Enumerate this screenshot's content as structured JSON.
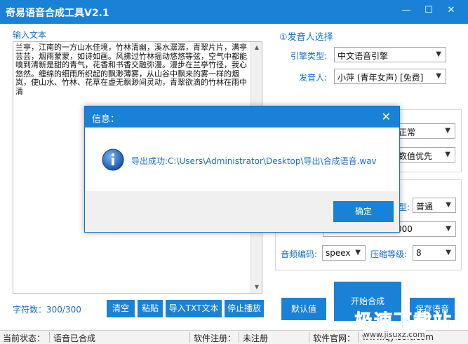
{
  "window": {
    "title": "奇易语音合成工具V2.1"
  },
  "left": {
    "section_label": "输入文本",
    "text_content": "兰亭，江南的一方山水佳境，竹林清幽，溪水潺潺，青翠片片，满亭芸芸，烟雨蒙蒙，如诗如画。风拂过竹林摇动悠悠等弦，空气中都能嗅到清新是甜的青气，花香和书香交融弥漫。漫步在兰亭竹径，我心悠然。缠绵的细雨所织起的飘渺薄雾，从山谷中飘来的雾一样的烟岚，使山水、竹林、花草在虚无飘渺间灵动，青翠欲滴的竹林在雨中清",
    "char_count_label": "字符数：",
    "char_count": "300/300",
    "buttons": {
      "clear": "清空",
      "paste": "粘贴",
      "import_txt": "导入TXT文本",
      "stop_play": "停止播放"
    }
  },
  "right": {
    "speaker_section": "①发音人选择",
    "engine_label": "引擎类型:",
    "engine_value": "中文语音引擎",
    "speaker_label": "发音人:",
    "speaker_value": "小萍 (青年女声) [免费]",
    "speed_value": "正常",
    "number_mode_value": "数值优先",
    "format_label_partial": "型:",
    "format_value": "普通",
    "samplerate_value": "000",
    "codec_label": "音频编码:",
    "codec_value": "speex",
    "compress_label": "压缩等级:",
    "compress_value": "8",
    "default_button": "默认值",
    "start_button": "开始合成",
    "save_button": "保存语音"
  },
  "statusbar": {
    "current_status_label": "当前状态：",
    "current_status_value": "语音已合成",
    "register_label": "软件注册：",
    "register_value": "未注册",
    "website_label": "软件官网：",
    "website_value": "www.qyisoft.com"
  },
  "dialog": {
    "title": "信息：",
    "message": "导出成功:C:\\Users\\Administrator\\Desktop\\导出\\合成语音.wav",
    "ok_button": "确定"
  },
  "watermark": {
    "title": "极速下载站",
    "url": "www.jisuxz.com"
  },
  "colors": {
    "accent": "#1a82d6",
    "label_blue": "#1a6fc4",
    "dialog_footer": "#f0f0f0"
  }
}
